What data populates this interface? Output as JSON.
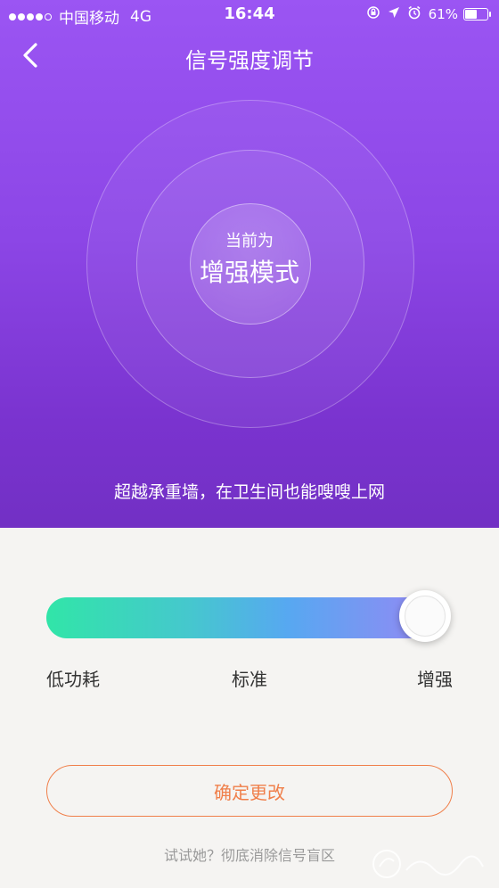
{
  "status_bar": {
    "carrier": "中国移动",
    "network": "4G",
    "time": "16:44",
    "battery": "61%",
    "battery_level": 0.61,
    "icons": [
      "orientation-lock-icon",
      "location-icon",
      "alarm-icon"
    ]
  },
  "nav": {
    "title": "信号强度调节",
    "back_icon": "chevron-left-icon"
  },
  "mode": {
    "caption": "当前为",
    "value": "增强模式"
  },
  "tagline": "超越承重墙，在卫生间也能嗖嗖上网",
  "slider": {
    "labels": [
      "低功耗",
      "标准",
      "增强"
    ],
    "selected": "增强",
    "position_fraction": 1.0
  },
  "confirm_button": "确定更改",
  "footer_link": "试试她？彻底消除信号盲区",
  "colors": {
    "hero_top": "#9b55f3",
    "hero_bottom": "#7230c4",
    "slider_start": "#31e5a8",
    "slider_end": "#9b85f4",
    "accent_orange": "#f07f4a"
  }
}
